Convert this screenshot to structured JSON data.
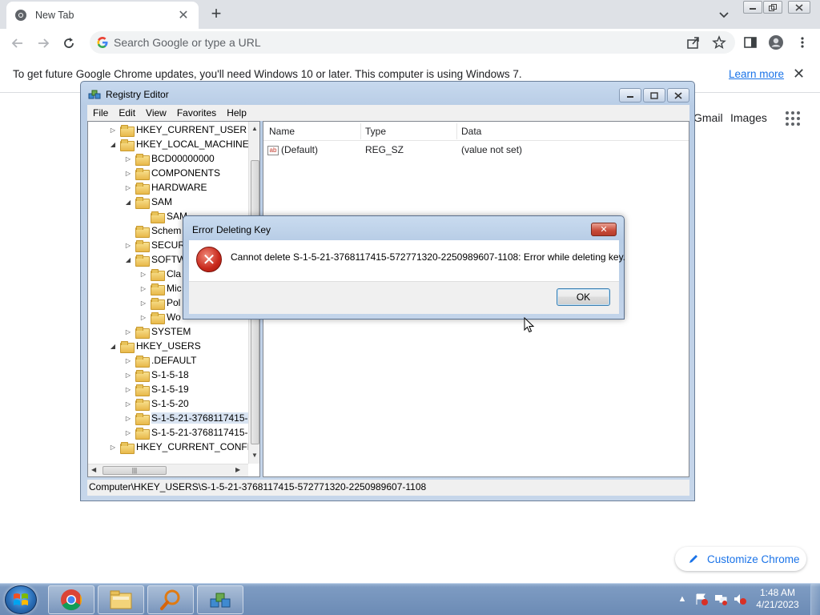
{
  "browser": {
    "tab_title": "New Tab",
    "tab_close": "✕",
    "new_tab": "+",
    "omnibox_placeholder": "Search Google or type a URL",
    "infobar_message": "To get future Google Chrome updates, you'll need Windows 10 or later. This computer is using Windows 7.",
    "infobar_link": "Learn more",
    "infobar_close": "✕",
    "ntp_links": [
      "Gmail",
      "Images"
    ],
    "customize_label": "Customize Chrome"
  },
  "regedit": {
    "title": "Registry Editor",
    "menu": [
      "File",
      "Edit",
      "View",
      "Favorites",
      "Help"
    ],
    "tree": [
      {
        "label": "HKEY_CURRENT_USER",
        "expander": "▷"
      },
      {
        "label": "HKEY_LOCAL_MACHINE",
        "expander": "◢"
      },
      {
        "label": "BCD00000000",
        "expander": "▷"
      },
      {
        "label": "COMPONENTS",
        "expander": "▷"
      },
      {
        "label": "HARDWARE",
        "expander": "▷"
      },
      {
        "label": "SAM",
        "expander": "◢"
      },
      {
        "label": "SAM",
        "expander": ""
      },
      {
        "label": "Schem",
        "expander": ""
      },
      {
        "label": "SECUR",
        "expander": "▷"
      },
      {
        "label": "SOFTW",
        "expander": "◢"
      },
      {
        "label": "Cla",
        "expander": "▷"
      },
      {
        "label": "Mic",
        "expander": "▷"
      },
      {
        "label": "Pol",
        "expander": "▷"
      },
      {
        "label": "Wo",
        "expander": "▷"
      },
      {
        "label": "SYSTEM",
        "expander": "▷"
      },
      {
        "label": "HKEY_USERS",
        "expander": "◢"
      },
      {
        "label": ".DEFAULT",
        "expander": "▷"
      },
      {
        "label": "S-1-5-18",
        "expander": "▷"
      },
      {
        "label": "S-1-5-19",
        "expander": "▷"
      },
      {
        "label": "S-1-5-20",
        "expander": "▷"
      },
      {
        "label": "S-1-5-21-3768117415-",
        "expander": "▷"
      },
      {
        "label": "S-1-5-21-3768117415-",
        "expander": "▷"
      },
      {
        "label": "HKEY_CURRENT_CONFIG",
        "expander": "▷"
      }
    ],
    "columns": [
      "Name",
      "Type",
      "Data"
    ],
    "rows": [
      {
        "name": "(Default)",
        "type": "REG_SZ",
        "data": "(value not set)"
      }
    ],
    "status": "Computer\\HKEY_USERS\\S-1-5-21-3768117415-572771320-2250989607-1108"
  },
  "dialog": {
    "title": "Error Deleting Key",
    "message": "Cannot delete S-1-5-21-3768117415-572771320-2250989607-1108:  Error while deleting key.",
    "ok_label": "OK",
    "close_glyph": "✕",
    "icon_glyph": "✕"
  },
  "taskbar": {
    "time": "1:48 AM",
    "date": "4/21/2023",
    "tray_arrow": "▲"
  }
}
